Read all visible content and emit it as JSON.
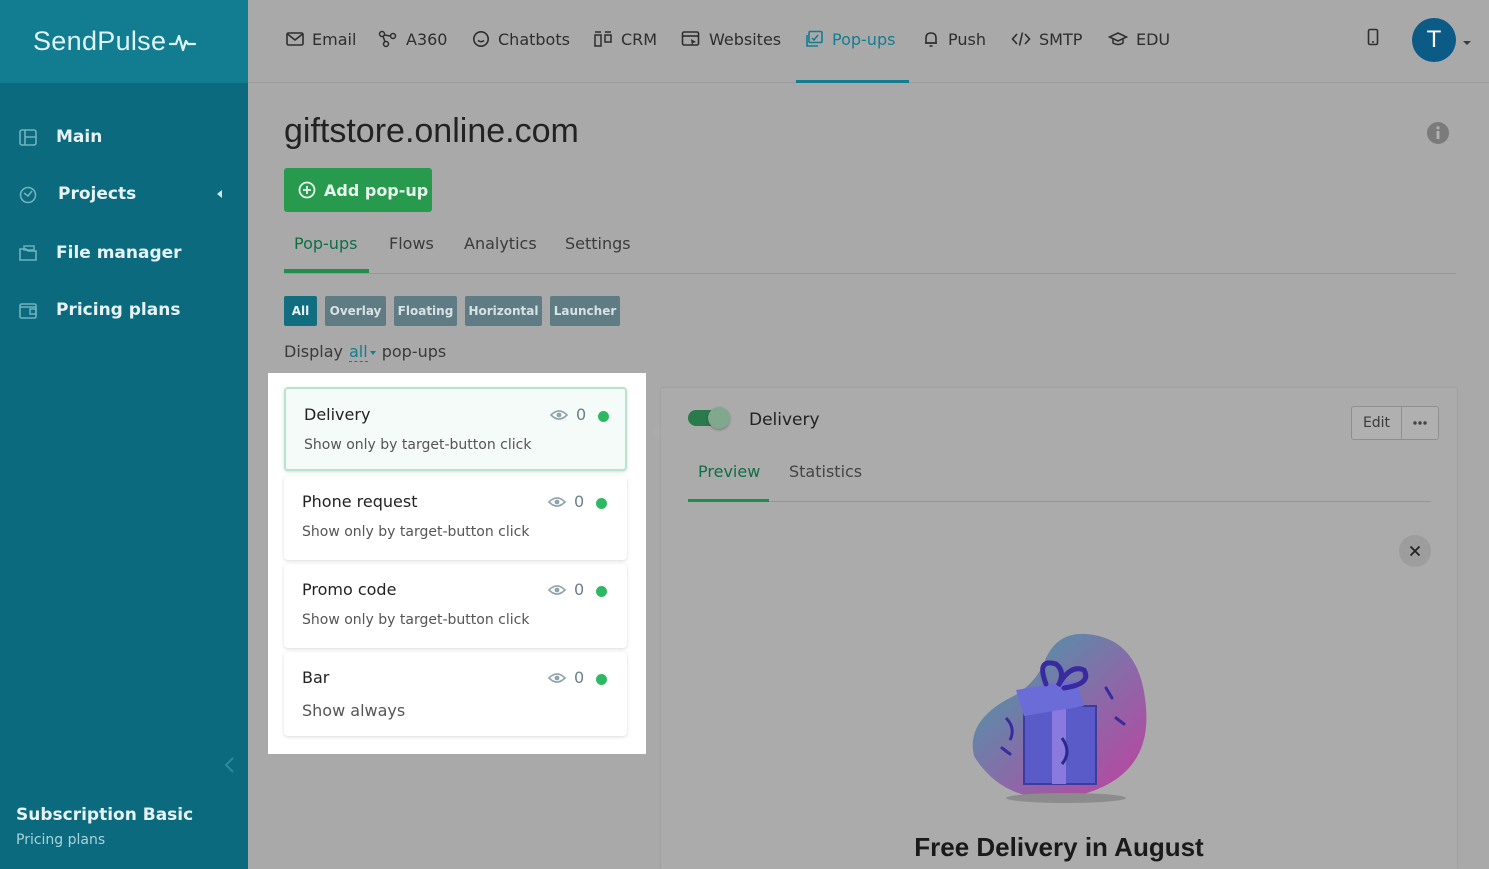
{
  "brand": {
    "name": "SendPulse"
  },
  "sidebar": {
    "items": [
      {
        "label": "Main",
        "icon": "dashboard-icon"
      },
      {
        "label": "Projects",
        "icon": "projects-icon"
      },
      {
        "label": "File manager",
        "icon": "folder-icon"
      },
      {
        "label": "Pricing plans",
        "icon": "wallet-icon"
      }
    ],
    "subscription_title": "Subscription Basic",
    "subscription_link": "Pricing plans"
  },
  "topnav": {
    "items": [
      {
        "label": "Email",
        "icon": "envelope-icon"
      },
      {
        "label": "A360",
        "icon": "automation-icon"
      },
      {
        "label": "Chatbots",
        "icon": "chat-icon"
      },
      {
        "label": "CRM",
        "icon": "crm-icon"
      },
      {
        "label": "Websites",
        "icon": "website-icon"
      },
      {
        "label": "Pop-ups",
        "icon": "popup-icon",
        "active": true
      },
      {
        "label": "Push",
        "icon": "bell-icon"
      },
      {
        "label": "SMTP",
        "icon": "code-icon"
      },
      {
        "label": "EDU",
        "icon": "graduation-cap-icon"
      }
    ],
    "avatar_letter": "T"
  },
  "page": {
    "title": "giftstore.online.com",
    "add_button": "Add pop-up"
  },
  "tabs": [
    "Pop-ups",
    "Flows",
    "Analytics",
    "Settings"
  ],
  "filters": [
    "All",
    "Overlay",
    "Floating",
    "Horizontal",
    "Launcher"
  ],
  "display": {
    "prefix": "Display",
    "value": "all",
    "suffix": "pop-ups"
  },
  "popups": [
    {
      "title": "Delivery",
      "subtitle": "Show only by target-button click",
      "views": "0",
      "status_color": "#2fb864"
    },
    {
      "title": "Phone request",
      "subtitle": "Show only by target-button click",
      "views": "0",
      "status_color": "#2fb864"
    },
    {
      "title": "Promo code",
      "subtitle": "Show only by target-button click",
      "views": "0",
      "status_color": "#2fb864"
    },
    {
      "title": "Bar",
      "subtitle": "Show always",
      "views": "0",
      "status_color": "#2fb864"
    }
  ],
  "preview": {
    "title": "Delivery",
    "edit_label": "Edit",
    "tabs": [
      "Preview",
      "Statistics"
    ],
    "headline": "Free Delivery in August"
  },
  "colors": {
    "sidebar": "#0b6a7d",
    "accent": "#127d90",
    "primary_green": "#279a4e",
    "status_active": "#2fb864"
  }
}
